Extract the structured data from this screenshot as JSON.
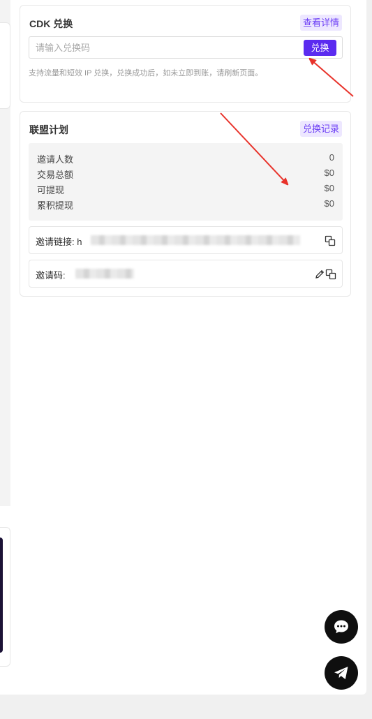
{
  "cdk": {
    "title": "CDK 兑换",
    "details_link": "查看详情",
    "input_placeholder": "请输入兑换码",
    "redeem_button": "兑换",
    "hint": "支持流量和短效 IP 兑换，兑换成功后，如未立即到账，请刷新页面。"
  },
  "affiliate": {
    "title": "联盟计划",
    "records_link": "兑换记录",
    "stats": [
      {
        "label": "邀请人数",
        "value": "0"
      },
      {
        "label": "交易总额",
        "value": "$0"
      },
      {
        "label": "可提现",
        "value": "$0"
      },
      {
        "label": "累积提现",
        "value": "$0"
      }
    ],
    "invite_link_label": "邀请链接: h",
    "invite_code_label": "邀请码:"
  },
  "icons": {
    "copy": "copy-icon",
    "edit": "pencil-icon",
    "chat": "chat-bubble-icon",
    "telegram": "paper-plane-icon"
  },
  "colors": {
    "accent": "#5b2bf0",
    "link_bg": "#ede7ff",
    "arrow": "#e8322a"
  }
}
